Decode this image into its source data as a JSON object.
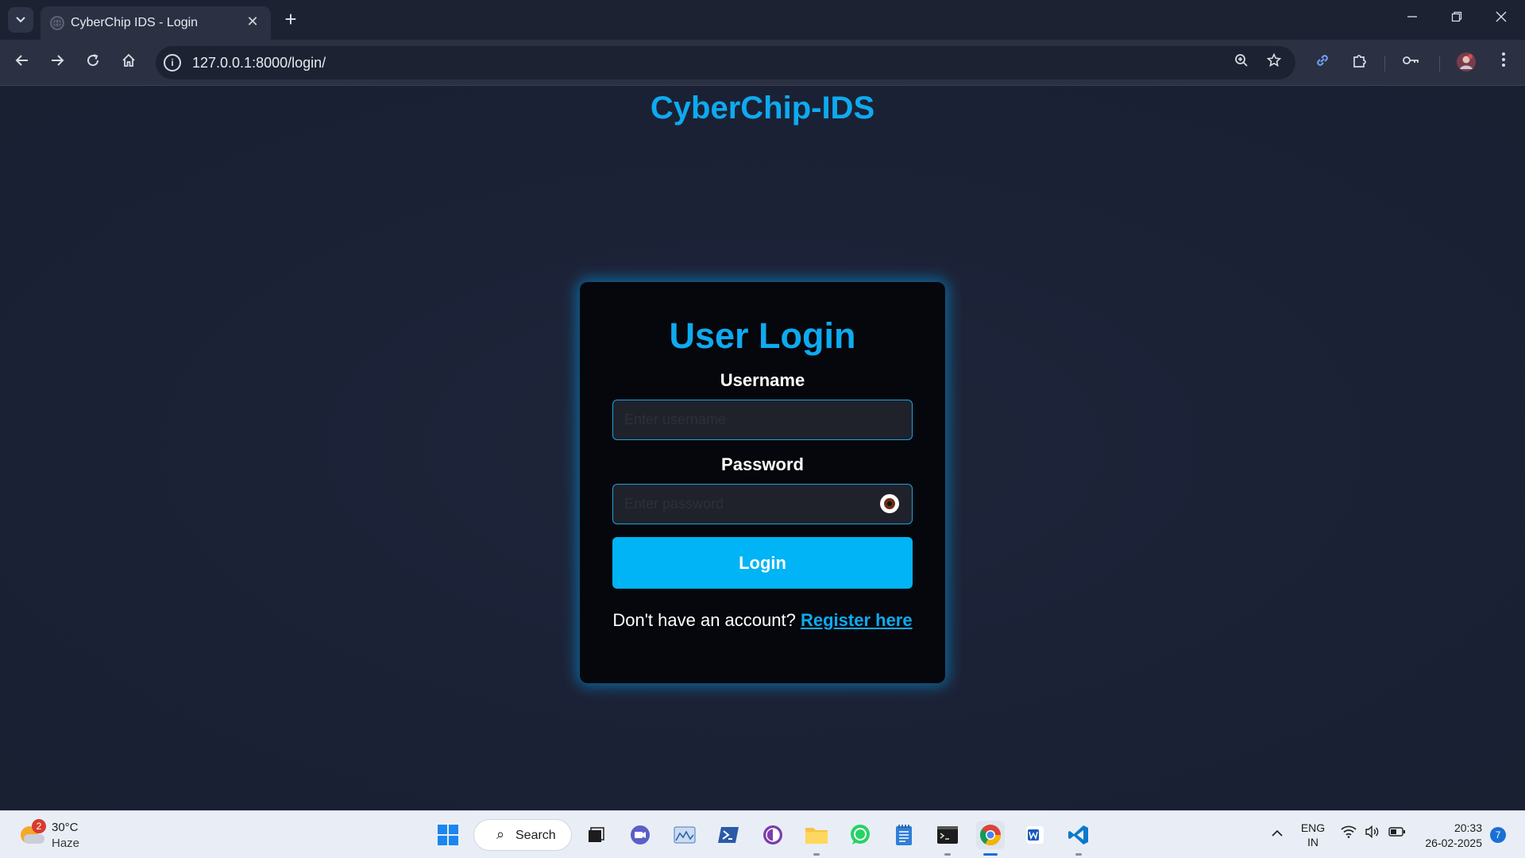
{
  "browser": {
    "tab_title": "CyberChip IDS - Login",
    "url": "127.0.0.1:8000/login/",
    "new_tab_label": "+",
    "tab_close_label": "✕"
  },
  "page": {
    "site_title": "CyberChip-IDS",
    "heading": "User Login",
    "username_label": "Username",
    "username_placeholder": "Enter username",
    "password_label": "Password",
    "password_placeholder": "Enter password",
    "login_button": "Login",
    "register_prompt": "Don't have an account?",
    "register_link": "Register here",
    "accent_color": "#0eaaf0"
  },
  "taskbar": {
    "weather_temp": "30°C",
    "weather_desc": "Haze",
    "weather_badge": "2",
    "search_label": "Search",
    "lang_line1": "ENG",
    "lang_line2": "IN",
    "time": "20:33",
    "date": "26-02-2025",
    "notification_count": "7"
  }
}
